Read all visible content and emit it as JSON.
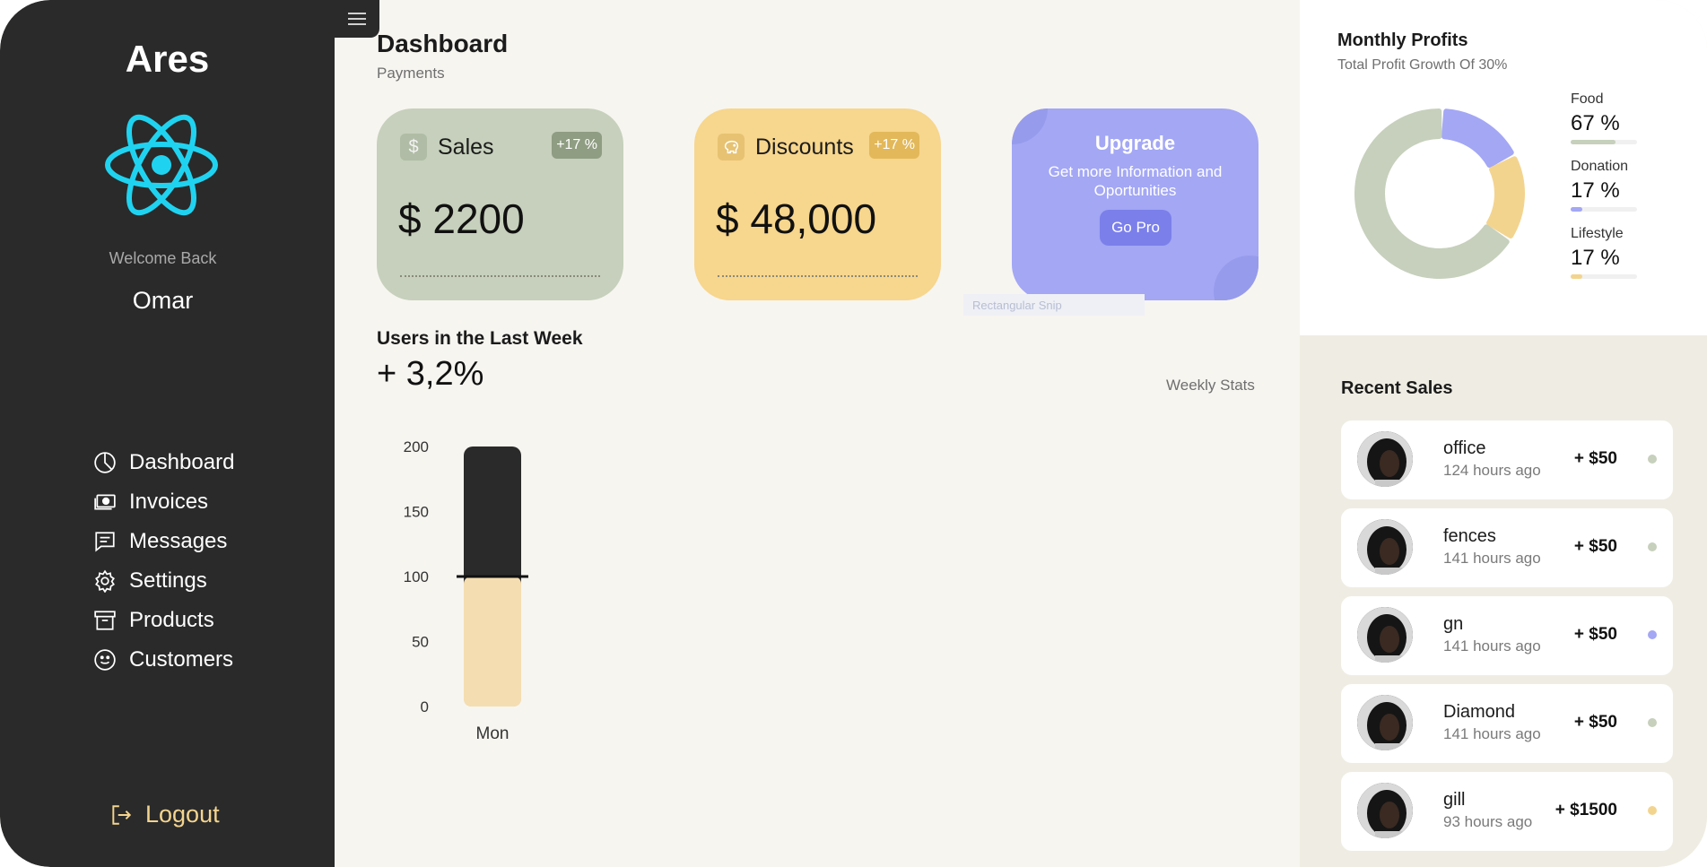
{
  "sidebar": {
    "brand": "Ares",
    "welcome": "Welcome Back",
    "username": "Omar",
    "nav": [
      {
        "label": "Dashboard",
        "icon": "pie-chart-icon"
      },
      {
        "label": "Invoices",
        "icon": "cash-icon"
      },
      {
        "label": "Messages",
        "icon": "message-icon"
      },
      {
        "label": "Settings",
        "icon": "gear-icon"
      },
      {
        "label": "Products",
        "icon": "archive-box-icon"
      },
      {
        "label": "Customers",
        "icon": "smiley-icon"
      }
    ],
    "logout": "Logout",
    "accent": "#f3d48f",
    "logo_color": "#1fd3f0"
  },
  "header": {
    "title": "Dashboard",
    "subtitle": "Payments"
  },
  "cards": {
    "sales": {
      "label": "Sales",
      "badge": "+17 %",
      "value": "$ 2200",
      "icon": "$",
      "color": "#c6d0bc"
    },
    "discounts": {
      "label": "Discounts",
      "badge": "+17 %",
      "value": "$ 48,000",
      "icon": "piggy-bank-icon",
      "color": "#f7d68d"
    },
    "upgrade": {
      "title": "Upgrade",
      "text": "Get more Information and Oportunities",
      "button": "Go Pro",
      "color": "#a3a7f4"
    }
  },
  "snip_label": "Rectangular Snip",
  "users": {
    "title": "Users in the Last Week",
    "value": "+ 3,2%",
    "weekly_label": "Weekly Stats"
  },
  "chart_data": {
    "type": "bar",
    "categories": [
      "Mon"
    ],
    "values": [
      200
    ],
    "marker": 100,
    "ylim": [
      0,
      200
    ],
    "yticks": [
      "200",
      "150",
      "100",
      "50",
      "0"
    ],
    "title": "",
    "xlabel": "",
    "ylabel": ""
  },
  "profits": {
    "title": "Monthly Profits",
    "subtitle": "Total Profit Growth Of 30%",
    "items": [
      {
        "name": "Food",
        "value": "67 %",
        "pct": 67,
        "color": "#c6d0bc"
      },
      {
        "name": "Donation",
        "value": "17 %",
        "pct": 17,
        "color": "#a3a7f4"
      },
      {
        "name": "Lifestyle",
        "value": "17 %",
        "pct": 17,
        "color": "#f3d48f"
      }
    ]
  },
  "recent": {
    "title": "Recent Sales",
    "items": [
      {
        "name": "office",
        "time": "124 hours ago",
        "amount": "+ $50",
        "dot": "#c6d0bc"
      },
      {
        "name": "fences",
        "time": "141 hours ago",
        "amount": "+ $50",
        "dot": "#c6d0bc"
      },
      {
        "name": "gn",
        "time": "141 hours ago",
        "amount": "+ $50",
        "dot": "#a3a7f4"
      },
      {
        "name": "Diamond",
        "time": "141 hours ago",
        "amount": "+ $50",
        "dot": "#c6d0bc"
      },
      {
        "name": "gill",
        "time": "93 hours ago",
        "amount": "+ $1500",
        "dot": "#f3d48f"
      }
    ]
  }
}
